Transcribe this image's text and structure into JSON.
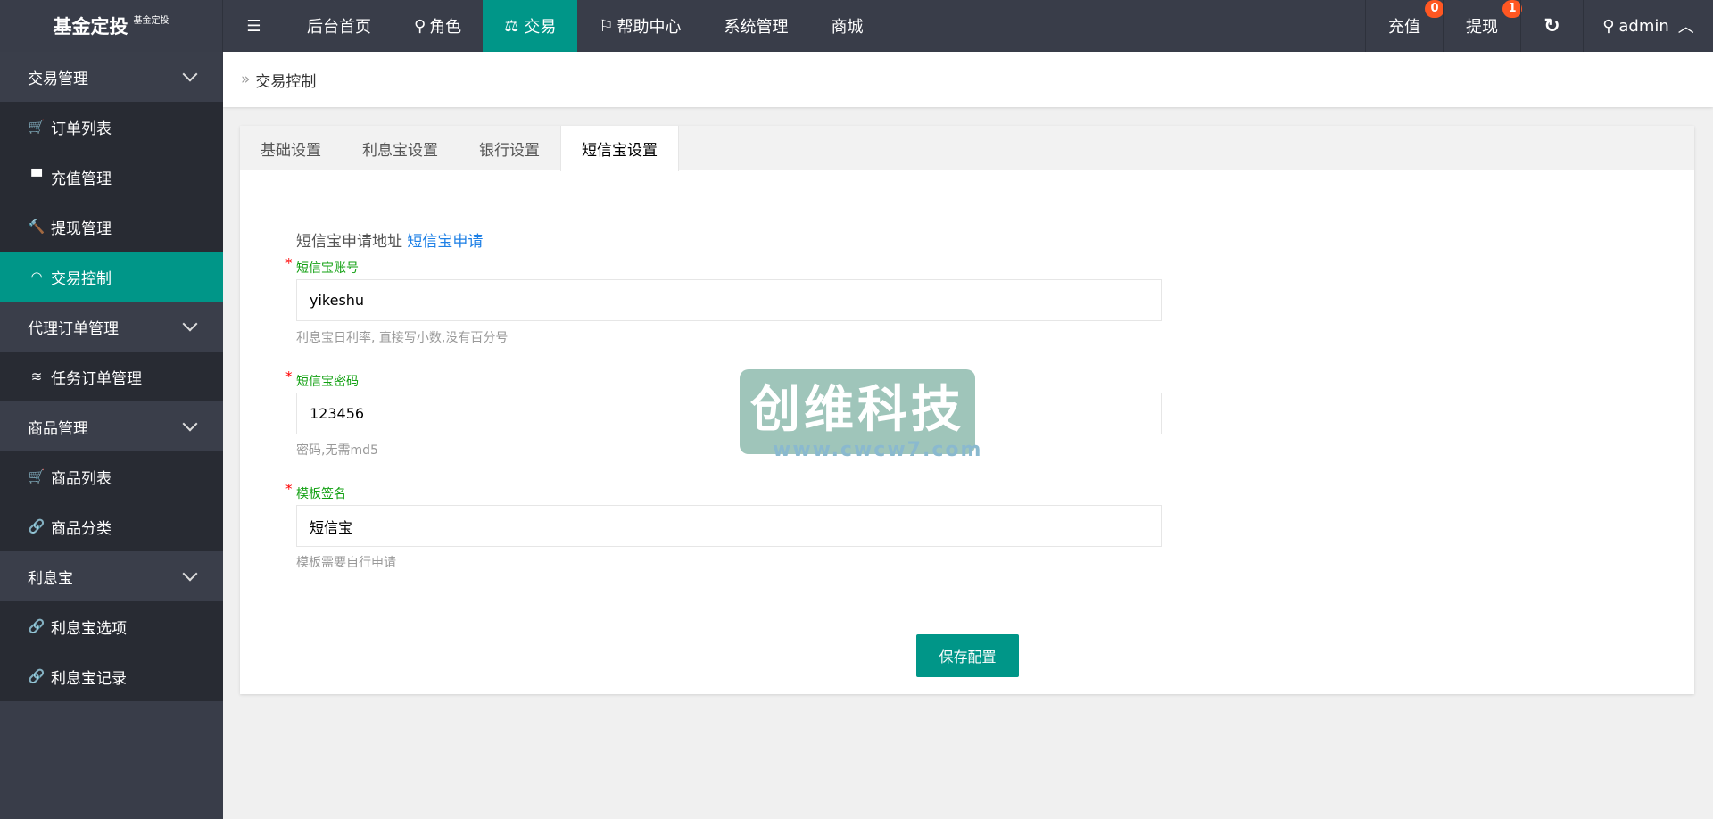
{
  "header": {
    "logo": "基金定投",
    "logo_sub": "基金定投",
    "nav": [
      {
        "label": "后台首页",
        "icon": ""
      },
      {
        "label": "角色",
        "icon": "user-icon"
      },
      {
        "label": "交易",
        "icon": "scale-icon"
      },
      {
        "label": "帮助中心",
        "icon": "flag-icon"
      },
      {
        "label": "系统管理",
        "icon": ""
      },
      {
        "label": "商城",
        "icon": ""
      }
    ],
    "recharge": "充值",
    "recharge_badge": "0",
    "withdraw": "提现",
    "withdraw_badge": "1",
    "user": "admin"
  },
  "sidebar": [
    {
      "label": "交易管理",
      "children": [
        {
          "label": "订单列表",
          "icon": "🛒"
        },
        {
          "label": "充值管理",
          "icon": "▀"
        },
        {
          "label": "提现管理",
          "icon": "🔨"
        },
        {
          "label": "交易控制",
          "icon": "◠",
          "active": true
        }
      ]
    },
    {
      "label": "代理订单管理",
      "children": [
        {
          "label": "任务订单管理",
          "icon": "≋"
        }
      ]
    },
    {
      "label": "商品管理",
      "children": [
        {
          "label": "商品列表",
          "icon": "🛒"
        },
        {
          "label": "商品分类",
          "icon": "🔗"
        }
      ]
    },
    {
      "label": "利息宝",
      "children": [
        {
          "label": "利息宝选项",
          "icon": "🔗"
        },
        {
          "label": "利息宝记录",
          "icon": "🔗"
        }
      ]
    }
  ],
  "breadcrumb": "交易控制",
  "tabs": [
    "基础设置",
    "利息宝设置",
    "银行设置",
    "短信宝设置"
  ],
  "form": {
    "addr_label": "短信宝申请地址",
    "addr_link": "短信宝申请",
    "fields": [
      {
        "label": "短信宝账号",
        "value": "yikeshu",
        "help": "利息宝日利率, 直接写小数,没有百分号"
      },
      {
        "label": "短信宝密码",
        "value": "123456",
        "help": "密码,无需md5"
      },
      {
        "label": "模板签名",
        "value": "短信宝",
        "help": "模板需要自行申请"
      }
    ],
    "save": "保存配置"
  },
  "watermark": {
    "title": "创维科技",
    "url": "www.cwcw7.com"
  },
  "colors": {
    "accent": "#009688",
    "topbar": "#393d49",
    "badge": "#ff5722"
  }
}
